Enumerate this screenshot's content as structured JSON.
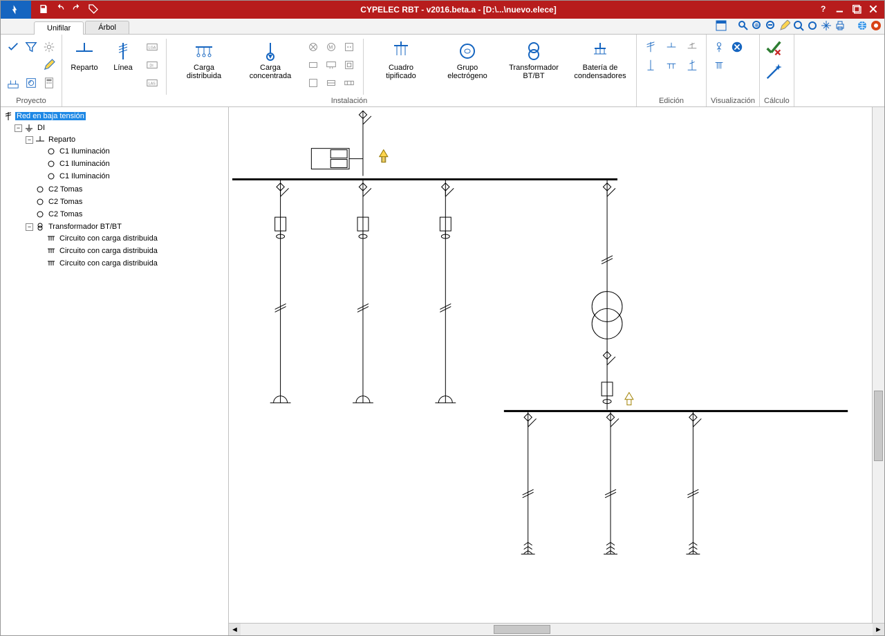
{
  "title": "CYPELEC RBT - v2016.beta.a - [D:\\...\\nuevo.elece]",
  "tabs": {
    "unifilar": "Unifilar",
    "arbol": "Árbol"
  },
  "ribbon": {
    "proyecto": "Proyecto",
    "reparto": "Reparto",
    "linea": "Línea",
    "carga_dist": "Carga distribuida",
    "carga_conc": "Carga concentrada",
    "cuadro": "Cuadro tipificado",
    "grupo": "Grupo electrógeno",
    "trafo": "Transformador BT/BT",
    "bateria": "Batería de condensadores",
    "instalacion": "Instalación",
    "edicion": "Edición",
    "visualizacion": "Visualización",
    "calculo": "Cálculo"
  },
  "tree": {
    "root": "Red en baja tensión",
    "di": "DI",
    "reparto": "Reparto",
    "c1": "C1 Iluminación",
    "c2": "C2 Tomas",
    "trafo": "Transformador BT/BT",
    "circ": "Circuito con carga distribuida"
  }
}
